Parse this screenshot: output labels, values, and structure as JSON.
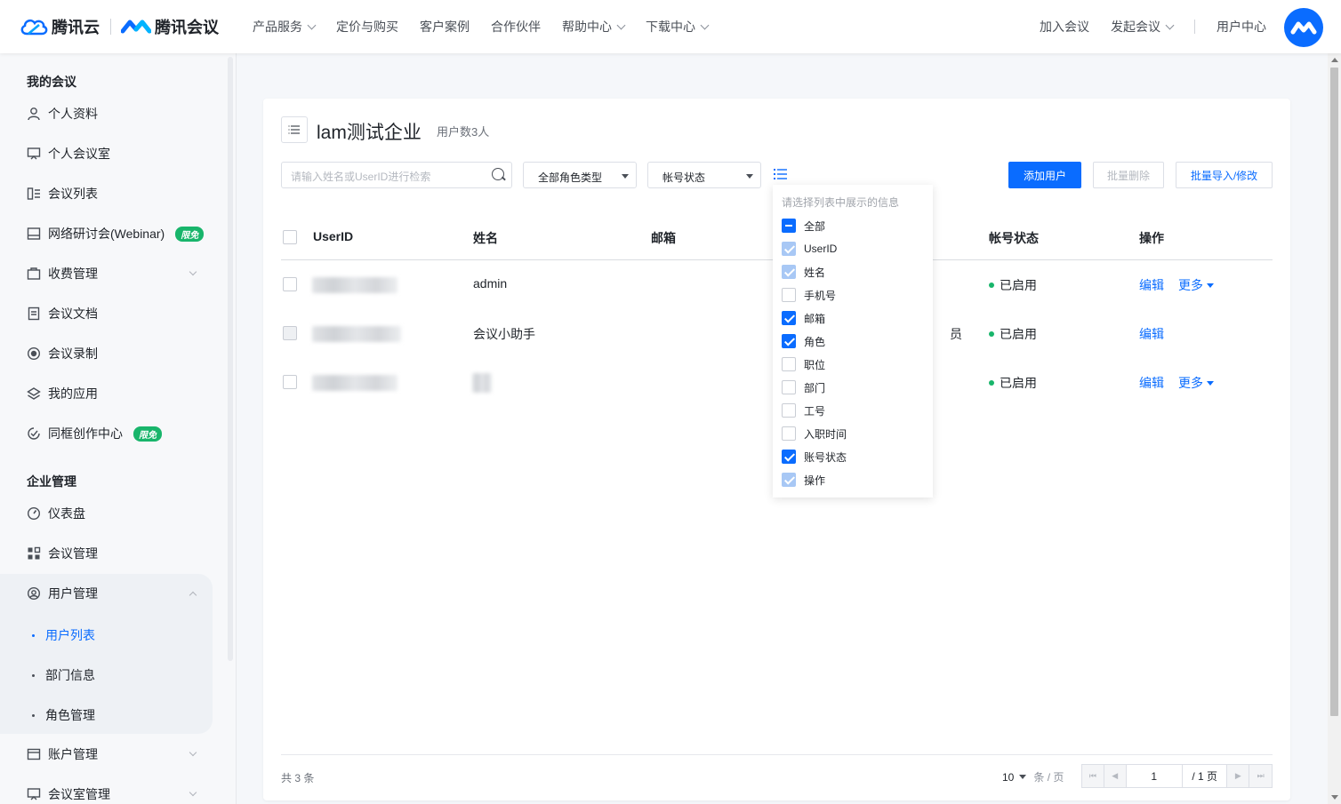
{
  "brand": {
    "tencent_cloud": "腾讯云",
    "tencent_meeting": "腾讯会议",
    "accent": "#0a6cff"
  },
  "nav": {
    "items": [
      "产品服务",
      "定价与购买",
      "客户案例",
      "合作伙伴",
      "帮助中心",
      "下载中心"
    ],
    "join": "加入会议",
    "start": "发起会议",
    "user_center": "用户中心"
  },
  "sidebar": {
    "section_my": "我的会议",
    "my_items": [
      "个人资料",
      "个人会议室",
      "会议列表",
      "网络研讨会(Webinar)",
      "收费管理",
      "会议文档",
      "会议录制",
      "我的应用",
      "同框创作中心"
    ],
    "badge": "限免",
    "section_ent": "企业管理",
    "ent_items": [
      "仪表盘",
      "会议管理",
      "用户管理",
      "账户管理",
      "会议室管理"
    ],
    "user_sub": [
      "用户列表",
      "部门信息",
      "角色管理"
    ]
  },
  "main": {
    "company": "lam测试企业",
    "user_count": "用户数3人",
    "search_placeholder": "请输入姓名或UserID进行检索",
    "role_select": "全部角色类型",
    "status_select": "帐号状态",
    "add_user": "添加用户",
    "batch_delete": "批量删除",
    "batch_import": "批量导入/修改"
  },
  "table": {
    "headers": {
      "userid": "UserID",
      "name": "姓名",
      "email": "邮箱",
      "status": "帐号状态",
      "action": "操作"
    },
    "rows": [
      {
        "name": "admin",
        "role_tail": "",
        "status": "已启用",
        "edit": "编辑",
        "more": "更多"
      },
      {
        "name": "会议小助手",
        "role_tail": "员",
        "status": "已启用",
        "edit": "编辑",
        "more": ""
      },
      {
        "name": "",
        "role_tail": "",
        "status": "已启用",
        "edit": "编辑",
        "more": "更多"
      }
    ]
  },
  "footer": {
    "total": "共 3 条",
    "page_size": "10",
    "page_size_unit": "条 / 页",
    "page": "1",
    "page_total": "/ 1 页"
  },
  "column_picker": {
    "title": "请选择列表中展示的信息",
    "options": [
      {
        "label": "全部",
        "state": "indeterminate"
      },
      {
        "label": "UserID",
        "state": "checked-disabled"
      },
      {
        "label": "姓名",
        "state": "checked-disabled"
      },
      {
        "label": "手机号",
        "state": "unchecked"
      },
      {
        "label": "邮箱",
        "state": "checked"
      },
      {
        "label": "角色",
        "state": "checked"
      },
      {
        "label": "职位",
        "state": "unchecked"
      },
      {
        "label": "部门",
        "state": "unchecked"
      },
      {
        "label": "工号",
        "state": "unchecked"
      },
      {
        "label": "入职时间",
        "state": "unchecked"
      },
      {
        "label": "账号状态",
        "state": "checked"
      },
      {
        "label": "操作",
        "state": "checked-disabled"
      }
    ]
  }
}
